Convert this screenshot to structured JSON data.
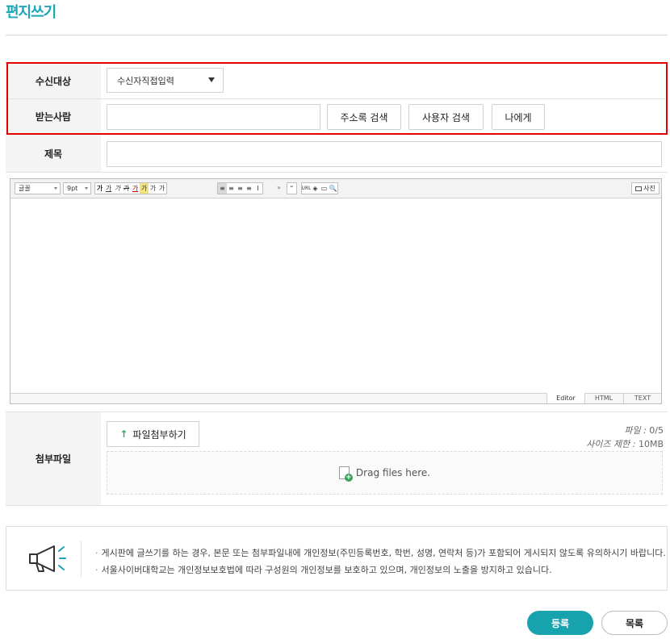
{
  "page": {
    "title": "편지쓰기"
  },
  "form": {
    "recipient_type": {
      "label": "수신대상",
      "selected": "수신자직접입력"
    },
    "receiver": {
      "label": "받는사람",
      "value": "",
      "buttons": {
        "address_book": "주소록 검색",
        "user_search": "사용자 검색",
        "to_me": "나에게"
      }
    },
    "subject": {
      "label": "제목",
      "value": ""
    },
    "editor": {
      "font_select": "글꼴",
      "size_select": "9pt",
      "toolbar_buttons": [
        "가",
        "가",
        "가",
        "가",
        "가",
        "가",
        "가",
        "가",
        "가",
        "≡",
        "≡",
        "≡",
        "≡",
        "I",
        "»",
        "“",
        "URL",
        "◈",
        "▭",
        "🔍"
      ],
      "photo_label": "사진",
      "modes": [
        "Editor",
        "HTML",
        "TEXT"
      ],
      "active_mode": "Editor"
    },
    "attachment": {
      "label": "첨부파일",
      "attach_button": "파일첨부하기",
      "file_count_label": "파일 :",
      "file_count_value": "0/5",
      "size_limit_label": "사이즈 제한 :",
      "size_limit_value": "10MB",
      "dropzone_text": "Drag files here."
    }
  },
  "notice": {
    "lines": [
      "게시판에 글쓰기를 하는 경우, 본문 또는 첨부파일내에 개인정보(주민등록번호, 학번, 성명, 연락처 등)가 포함되어 게시되지 않도록 유의하시기 바랍니다.",
      "서울사이버대학교는 개인정보보호법에 따라 구성원의 개인정보를 보호하고 있으며, 개인정보의 노출을 방지하고 있습니다."
    ]
  },
  "actions": {
    "submit": "등록",
    "list": "목록"
  },
  "colors": {
    "accent": "#1ba6b8",
    "highlight": "#e10000",
    "submit_bg": "#17a3ae"
  },
  "icons": {
    "notice": "megaphone-icon",
    "attach": "up-arrow-icon",
    "dropzone": "file-add-icon"
  }
}
